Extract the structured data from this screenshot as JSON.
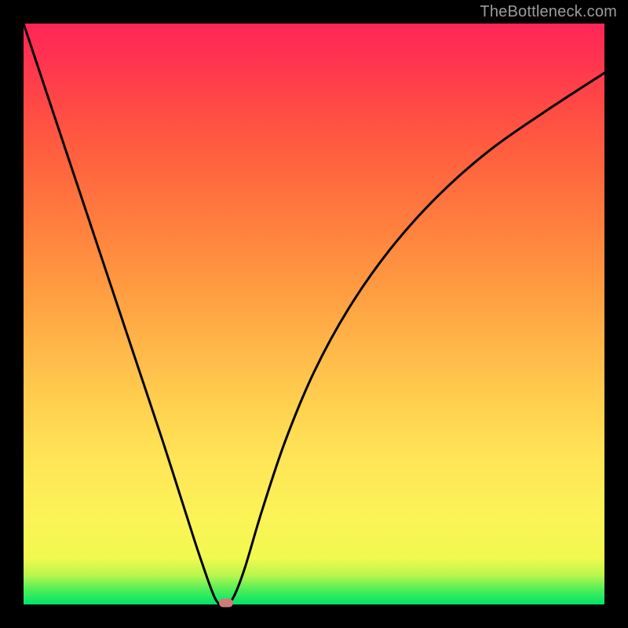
{
  "watermark": "TheBottleneck.com",
  "chart_data": {
    "type": "line",
    "title": "",
    "xlabel": "",
    "ylabel": "",
    "xlim": [
      0,
      1
    ],
    "ylim": [
      0,
      1
    ],
    "series": [
      {
        "name": "bottleneck-curve",
        "x": [
          0.0,
          0.04,
          0.08,
          0.12,
          0.16,
          0.2,
          0.24,
          0.28,
          0.305,
          0.33,
          0.345,
          0.36,
          0.38,
          0.41,
          0.45,
          0.5,
          0.56,
          0.63,
          0.71,
          0.8,
          0.9,
          1.0
        ],
        "y": [
          1.0,
          0.88,
          0.76,
          0.64,
          0.52,
          0.4,
          0.28,
          0.155,
          0.078,
          0.01,
          0.0,
          0.01,
          0.06,
          0.16,
          0.28,
          0.4,
          0.51,
          0.61,
          0.7,
          0.78,
          0.85,
          0.915
        ]
      }
    ],
    "marker": {
      "x": 0.348,
      "y": 0.003,
      "color": "#cf7a78"
    },
    "gradient_stops": [
      {
        "pos": 0.0,
        "color": "#00e46a"
      },
      {
        "pos": 0.03,
        "color": "#4dee58"
      },
      {
        "pos": 0.05,
        "color": "#b9f64e"
      },
      {
        "pos": 0.08,
        "color": "#f1f94f"
      },
      {
        "pos": 0.15,
        "color": "#fbf357"
      },
      {
        "pos": 0.25,
        "color": "#ffe557"
      },
      {
        "pos": 0.35,
        "color": "#ffcf4f"
      },
      {
        "pos": 0.45,
        "color": "#ffb548"
      },
      {
        "pos": 0.55,
        "color": "#ff9a41"
      },
      {
        "pos": 0.65,
        "color": "#ff803e"
      },
      {
        "pos": 0.75,
        "color": "#ff663e"
      },
      {
        "pos": 0.85,
        "color": "#ff4c44"
      },
      {
        "pos": 0.95,
        "color": "#ff3151"
      },
      {
        "pos": 1.0,
        "color": "#ff2558"
      }
    ]
  }
}
